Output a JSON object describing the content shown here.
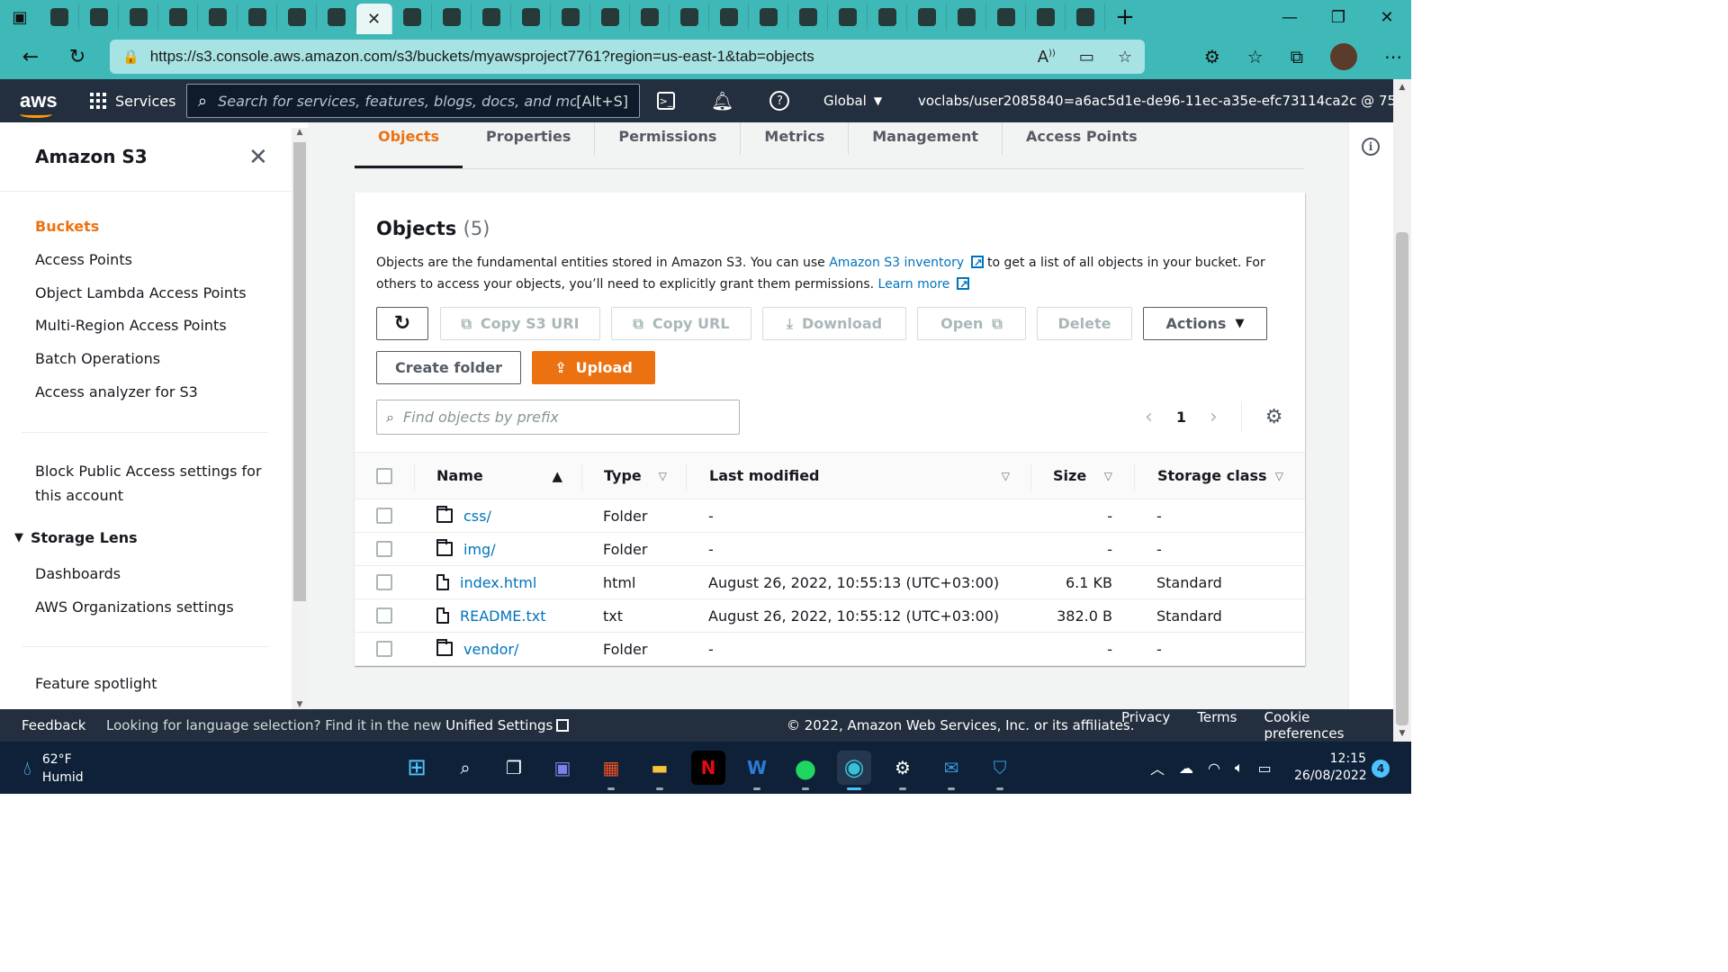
{
  "browser": {
    "tab_icons": [
      "github-icon",
      "alx-icon",
      "github-icon",
      "slack-icon",
      "github-icon",
      "docs-icon",
      "linkedin-icon",
      "app-icon",
      "close-icon",
      "app-icon",
      "app-icon",
      "app-icon",
      "app-icon",
      "cisco-icon",
      "cisco-icon",
      "font-icon",
      "app-icon",
      "search-icon",
      "app-icon",
      "app-icon",
      "file-icon",
      "search-icon",
      "github-icon",
      "pdf-icon",
      "file-icon",
      "pdf-icon",
      "pdf-icon"
    ],
    "url": "https://s3.console.aws.amazon.com/s3/buckets/myawsproject7761?region=us-east-1&tab=objects"
  },
  "aws_header": {
    "logo": "aws",
    "services_label": "Services",
    "search_placeholder": "Search for services, features, blogs, docs, and mor",
    "search_shortcut": "[Alt+S]",
    "region": "Global",
    "account": "voclabs/user2085840=a6ac5d1e-de96-11ec-a35e-efc73114ca2c @ 75..."
  },
  "sidenav": {
    "title": "Amazon S3",
    "items": [
      {
        "label": "Buckets",
        "active": true
      },
      {
        "label": "Access Points"
      },
      {
        "label": "Object Lambda Access Points"
      },
      {
        "label": "Multi-Region Access Points"
      },
      {
        "label": "Batch Operations"
      },
      {
        "label": "Access analyzer for S3"
      }
    ],
    "block_public_access": "Block Public Access settings for this account",
    "storage_lens": {
      "label": "Storage Lens",
      "items": [
        "Dashboards",
        "AWS Organizations settings"
      ]
    },
    "feature_spotlight": "Feature spotlight"
  },
  "tabs": [
    "Objects",
    "Properties",
    "Permissions",
    "Metrics",
    "Management",
    "Access Points"
  ],
  "objects_panel": {
    "title": "Objects",
    "count": "(5)",
    "desc_1": "Objects are the fundamental entities stored in Amazon S3. You can use ",
    "inventory_link": "Amazon S3 inventory",
    "desc_2": " to get a list of all objects in your bucket. For others to access your objects, you’ll need to explicitly grant them permissions. ",
    "learn_more": "Learn more",
    "buttons": {
      "copy_s3_uri": "Copy S3 URI",
      "copy_url": "Copy URL",
      "download": "Download",
      "open": "Open",
      "delete": "Delete",
      "actions": "Actions",
      "create_folder": "Create folder",
      "upload": "Upload"
    },
    "filter_placeholder": "Find objects by prefix",
    "page": "1",
    "columns": {
      "name": "Name",
      "type": "Type",
      "last_modified": "Last modified",
      "size": "Size",
      "storage_class": "Storage class"
    },
    "rows": [
      {
        "name": "css/",
        "icon": "folder-icon",
        "type": "Folder",
        "modified": "-",
        "size": "-",
        "storage_class": "-"
      },
      {
        "name": "img/",
        "icon": "folder-icon",
        "type": "Folder",
        "modified": "-",
        "size": "-",
        "storage_class": "-"
      },
      {
        "name": "index.html",
        "icon": "file-icon",
        "type": "html",
        "modified": "August 26, 2022, 10:55:13 (UTC+03:00)",
        "size": "6.1 KB",
        "storage_class": "Standard"
      },
      {
        "name": "README.txt",
        "icon": "file-icon",
        "type": "txt",
        "modified": "August 26, 2022, 10:55:12 (UTC+03:00)",
        "size": "382.0 B",
        "storage_class": "Standard"
      },
      {
        "name": "vendor/",
        "icon": "folder-icon",
        "type": "Folder",
        "modified": "-",
        "size": "-",
        "storage_class": "-"
      }
    ]
  },
  "footer": {
    "feedback": "Feedback",
    "lang_text": "Looking for language selection? Find it in the new ",
    "unified_settings": "Unified Settings",
    "copyright": "© 2022, Amazon Web Services, Inc. or its affiliates.",
    "privacy": "Privacy",
    "terms": "Terms",
    "cookie": "Cookie preferences"
  },
  "taskbar": {
    "temp": "62°F",
    "condition": "Humid",
    "time": "12:15",
    "date": "26/08/2022",
    "notifications": "4"
  },
  "colors": {
    "accent": "#ec7211",
    "link": "#0073bb",
    "aws_header": "#232f3e",
    "browser_chrome": "#3fb8b8"
  }
}
